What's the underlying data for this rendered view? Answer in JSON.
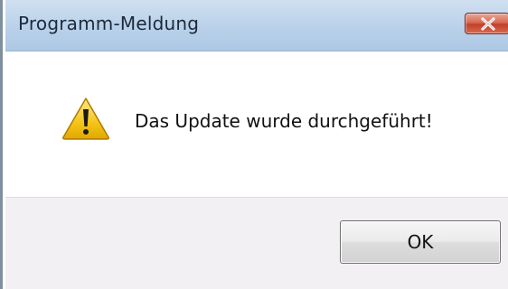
{
  "dialog": {
    "title": "Programm-Meldung",
    "message": "Das Update wurde durchgeführt!",
    "ok_label": "OK",
    "icon": "warning-icon",
    "close_icon": "close-icon"
  },
  "colors": {
    "titlebar": "#b9d1ea",
    "close_button": "#d96a52",
    "footer": "#f3f0f4",
    "warning_yellow": "#f5c518"
  }
}
